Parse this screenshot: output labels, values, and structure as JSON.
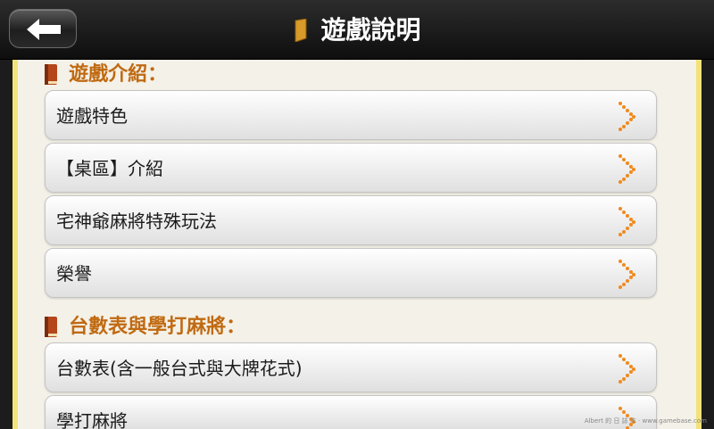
{
  "header": {
    "title": "遊戲說明"
  },
  "sections": [
    {
      "label": "遊戲介紹：",
      "items": [
        {
          "label": "遊戲特色"
        },
        {
          "label": "【桌區】介紹"
        },
        {
          "label": "宅神爺麻將特殊玩法"
        },
        {
          "label": "榮譽"
        }
      ]
    },
    {
      "label": "台數表與學打麻將：",
      "items": [
        {
          "label": "台數表(含一般台式與大牌花式)"
        },
        {
          "label": "學打麻將"
        }
      ]
    }
  ],
  "watermark": "Albert 的 日 誌 本 · www.gamebase.com",
  "colors": {
    "section_text": "#c06a12",
    "chevron": "#f08a1c",
    "panel_border": "#f2e27a"
  }
}
